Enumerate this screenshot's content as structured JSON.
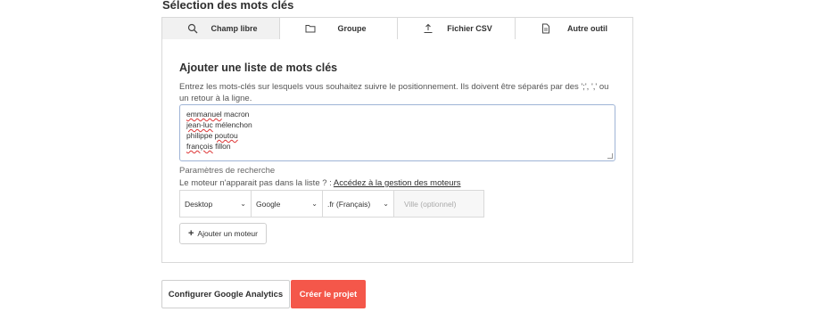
{
  "section_title": "Sélection des mots clés",
  "tabs": [
    {
      "label": "Champ libre",
      "icon": "search-icon",
      "active": true
    },
    {
      "label": "Groupe",
      "icon": "folder-icon",
      "active": false
    },
    {
      "label": "Fichier CSV",
      "icon": "upload-icon",
      "active": false
    },
    {
      "label": "Autre outil",
      "icon": "document-icon",
      "active": false
    }
  ],
  "panel": {
    "title": "Ajouter une liste de mots clés",
    "help": "Entrez les mots-clés sur lesquels vous souhaitez suivre le positionnement. Ils doivent être séparés par des ';', ',' ou un retour à la ligne.",
    "keywords": [
      {
        "misspelled": "emmanuel",
        "rest": " macron"
      },
      {
        "misspelled": "jean-luc",
        "rest": " mélenchon"
      },
      {
        "pre": "philippe ",
        "misspelled": "poutou",
        "rest": ""
      },
      {
        "misspelled": "françois",
        "rest": " fillon"
      }
    ],
    "params_label": "Paramètres de recherche",
    "engine_note": "Le moteur n'apparait pas dans la liste ? : ",
    "engine_link": "Accédez à la gestion des moteurs",
    "device": "Desktop",
    "engine": "Google",
    "domain": ".fr (Français)",
    "city_placeholder": "Ville (optionnel)",
    "add_engine_label": "Ajouter un moteur"
  },
  "buttons": {
    "configure_ga": "Configurer Google Analytics",
    "create_project": "Créer le projet"
  },
  "colors": {
    "accent": "#f4574a",
    "active_tab_bg": "#f1f1f1",
    "textarea_border": "#9fb4d6"
  }
}
